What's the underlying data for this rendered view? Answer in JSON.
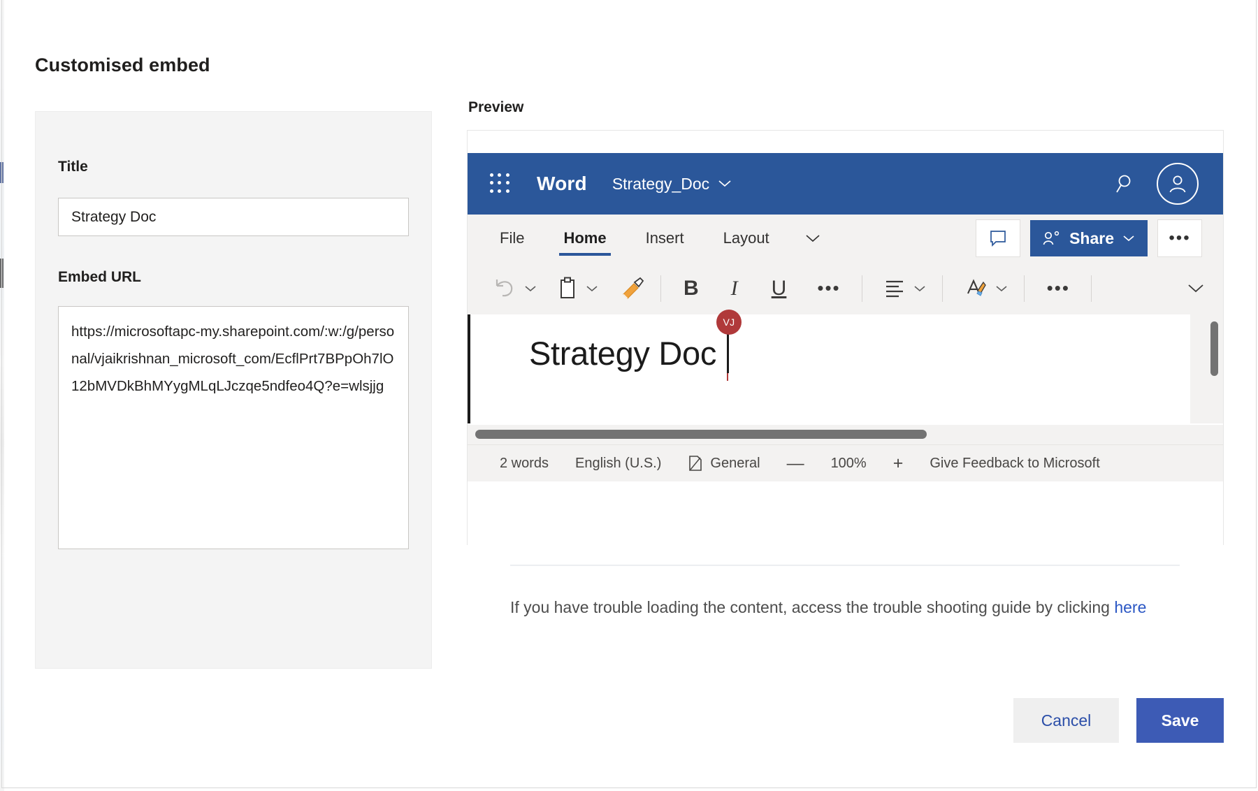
{
  "dialog": {
    "title": "Customised embed",
    "cancel_label": "Cancel",
    "save_label": "Save"
  },
  "form": {
    "title_label": "Title",
    "title_value": "Strategy Doc",
    "url_label": "Embed URL",
    "url_value": "https://microsoftapc-my.sharepoint.com/:w:/g/personal/vjaikrishnan_microsoft_com/EcflPrt7BPpOh7lO12bMVDkBhMYygMLqLJczqe5ndfeo4Q?e=wlsjjg"
  },
  "preview": {
    "label": "Preview",
    "app": {
      "name": "Word",
      "document_name": "Strategy_Doc",
      "waffle_icon": "app-launcher-icon",
      "search_icon": "search-icon",
      "account_icon": "account-avatar-icon",
      "dropdown_icon": "chevron-down-icon"
    },
    "ribbon": {
      "tabs": [
        {
          "label": "File",
          "active": false
        },
        {
          "label": "Home",
          "active": true
        },
        {
          "label": "Insert",
          "active": false
        },
        {
          "label": "Layout",
          "active": false
        }
      ],
      "more_tabs_icon": "chevron-down-icon",
      "comment_icon": "comment-icon",
      "share_label": "Share",
      "share_icon": "share-person-icon",
      "overflow_icon": "ellipsis-icon"
    },
    "toolbar": {
      "undo_icon": "undo-arrow-icon",
      "paste_icon": "clipboard-paste-icon",
      "format_painter_icon": "format-painter-icon",
      "bold_label": "B",
      "italic_label": "I",
      "underline_label": "U",
      "font_more_icon": "ellipsis-icon",
      "align_icon": "align-left-icon",
      "styles_icon": "text-highlight-pen-icon",
      "paragraph_more_icon": "ellipsis-icon",
      "expand_ribbon_icon": "chevron-down-icon"
    },
    "document": {
      "heading": "Strategy Doc",
      "presence_initials": "VJ",
      "presence_color": "#b0393a"
    },
    "status_bar": {
      "word_count": "2 words",
      "language": "English (U.S.)",
      "style_icon": "page-style-icon",
      "style_name": "General",
      "zoom_out_label": "—",
      "zoom_level": "100%",
      "zoom_in_label": "+",
      "feedback_label": "Give Feedback to Microsoft"
    },
    "trouble": {
      "text_before": "If you have trouble loading the content, access the trouble shooting guide by clicking ",
      "link_label": "here"
    }
  },
  "colors": {
    "word_blue": "#2b579a",
    "save_blue": "#3d5bb5",
    "link_blue": "#2b57c4",
    "panel_grey": "#f4f4f4",
    "ribbon_grey": "#f3f2f1"
  }
}
